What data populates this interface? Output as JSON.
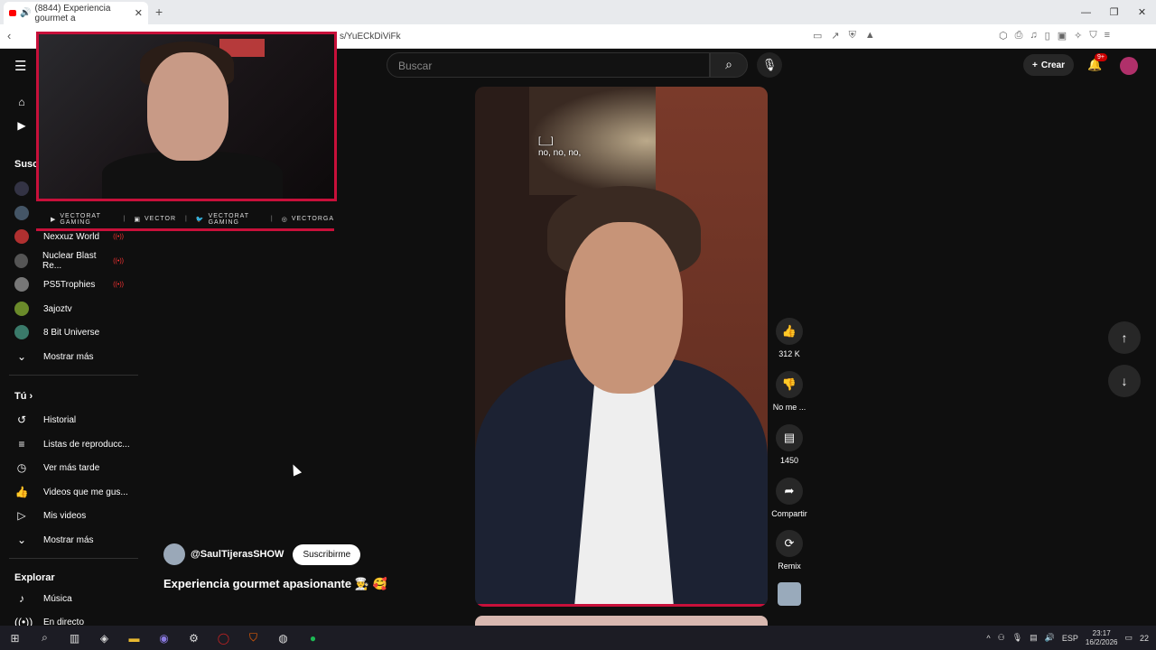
{
  "browser": {
    "tab_title": "(8844) Experiencia gourmet a",
    "url_fragment": "s/YuECkDiViFk"
  },
  "header": {
    "search_placeholder": "Buscar",
    "create_label": "Crear",
    "notif_badge": "9+"
  },
  "sidebar": {
    "subs_heading": "Susc",
    "subs": [
      {
        "label": "Nexxuz World",
        "live": true,
        "color": "#b03030"
      },
      {
        "label": "Nuclear Blast Re...",
        "live": true,
        "color": "#555"
      },
      {
        "label": "PS5Trophies",
        "live": true,
        "color": "#777"
      },
      {
        "label": "3ajoztv",
        "live": false,
        "color": "#6a8a2a"
      },
      {
        "label": "8 Bit Universe",
        "live": false,
        "color": "#3a7a6a"
      }
    ],
    "show_more_1": "Mostrar más",
    "you_heading": "Tú",
    "you_items": [
      {
        "label": "Historial",
        "icon": "history-icon"
      },
      {
        "label": "Listas de reproducc...",
        "icon": "playlist-icon"
      },
      {
        "label": "Ver más tarde",
        "icon": "clock-icon"
      },
      {
        "label": "Videos que me gus...",
        "icon": "thumbs-up-icon"
      },
      {
        "label": "Mis videos",
        "icon": "my-videos-icon"
      }
    ],
    "show_more_2": "Mostrar más",
    "explore_heading": "Explorar",
    "explore_items": [
      {
        "label": "Música",
        "icon": "music-icon"
      },
      {
        "label": "En directo",
        "icon": "live-icon"
      }
    ]
  },
  "overlay": {
    "social": [
      "VECTORAT GAMING",
      "VECTOR",
      "VECTORAT GAMING",
      "VECTORGA"
    ]
  },
  "video": {
    "caption_line1": "[__]",
    "caption_line2": "no, no, no,"
  },
  "actions": {
    "likes": "312 K",
    "dislike": "No me ...",
    "comments": "1450",
    "share": "Compartir",
    "remix": "Remix"
  },
  "channel": {
    "handle": "@SaulTijerasSHOW",
    "subscribe": "Suscribirme",
    "title": "Experiencia gourmet apasionante 👨‍🍳 🥰"
  },
  "taskbar": {
    "lang": "ESP",
    "time": "23:17",
    "date": "16/2/2026",
    "notif_count": "22"
  }
}
